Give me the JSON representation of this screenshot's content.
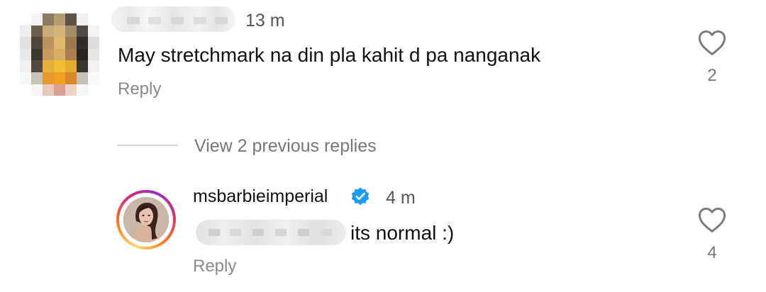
{
  "comment": {
    "time": "13 m",
    "text": "May stretchmark na din pla kahit d pa nanganak",
    "reply_label": "Reply",
    "likes": "2",
    "heart_icon": "heart-outline-icon"
  },
  "thread": {
    "view_previous_label": "View 2 previous replies"
  },
  "reply": {
    "username": "msbarbieimperial",
    "verified_icon": "verified-badge-icon",
    "time": "4 m",
    "text": "its normal :)",
    "reply_label": "Reply",
    "likes": "4",
    "heart_icon": "heart-outline-icon"
  },
  "colors": {
    "verified": "#1d9bf0",
    "secondary_text": "#8a8a8a",
    "story_ring": [
      "#feda75",
      "#fa7e1e",
      "#d62976",
      "#962fbf"
    ]
  }
}
